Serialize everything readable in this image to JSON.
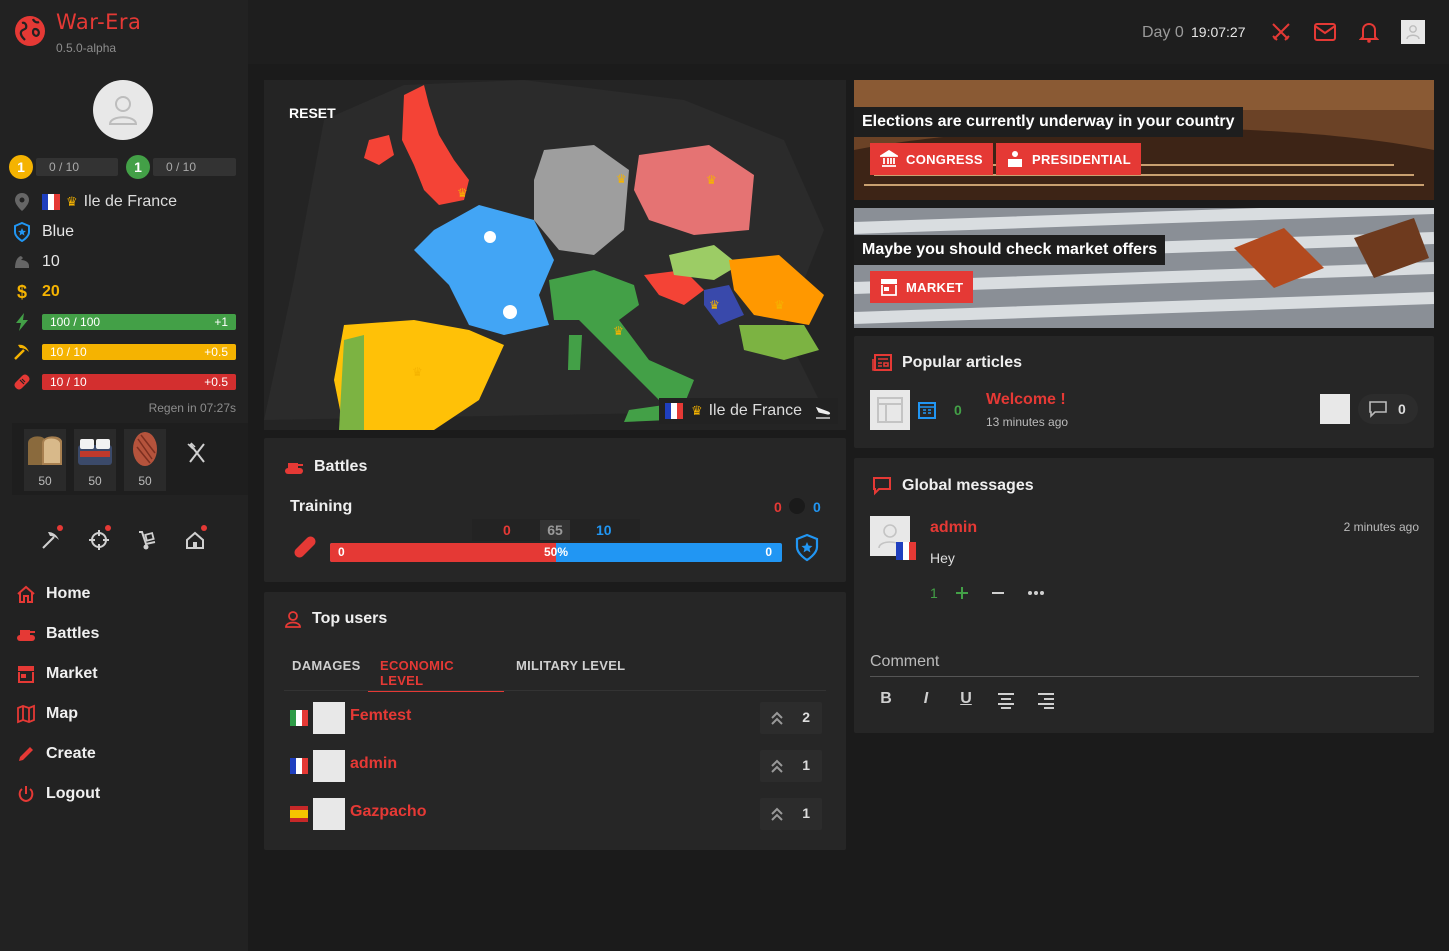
{
  "brand": {
    "name": "War-Era",
    "version": "0.5.0-alpha"
  },
  "header": {
    "day": "Day 0",
    "time": "19:07:27"
  },
  "colors": {
    "accent": "#e53935",
    "green": "#43a047",
    "yellow": "#f5b301",
    "blue": "#2196f3"
  },
  "profile": {
    "level_left": {
      "badge": "1",
      "value": "0 / 10"
    },
    "level_right": {
      "badge": "1",
      "value": "0 / 10"
    },
    "region": "Ile de France",
    "party": "Blue",
    "strength": "10",
    "money": "20",
    "energy": {
      "value": "100 / 100",
      "gain": "+1",
      "fraction": 1.0
    },
    "work": {
      "value": "10 / 10",
      "gain": "+0.5",
      "fraction": 1.0
    },
    "health": {
      "value": "10 / 10",
      "gain": "+0.5",
      "fraction": 1.0
    },
    "regen": "Regen in 07:27s"
  },
  "food": [
    {
      "name": "bread-icon",
      "count": "50"
    },
    {
      "name": "sushi-icon",
      "count": "50"
    },
    {
      "name": "steak-icon",
      "count": "50"
    }
  ],
  "nav": {
    "home": "Home",
    "battles": "Battles",
    "market": "Market",
    "map": "Map",
    "create": "Create",
    "logout": "Logout"
  },
  "map": {
    "reset": "RESET",
    "location": "Ile de France"
  },
  "banners": {
    "elections": {
      "title": "Elections are currently underway in your country",
      "congress": "CONGRESS",
      "presidential": "PRESIDENTIAL"
    },
    "market": {
      "title": "Maybe you should check market offers",
      "market": "MARKET"
    }
  },
  "battles": {
    "title": "Battles",
    "name": "Training",
    "score_left": "0",
    "score_right": "0",
    "stats_left": "0",
    "stats_mid": "65",
    "stats_right": "10",
    "bar_left": "0",
    "bar_mid": "50%",
    "bar_right": "0",
    "fraction": 0.5
  },
  "top_users": {
    "title": "Top users",
    "tabs": [
      "DAMAGES",
      "ECONOMIC LEVEL",
      "MILITARY LEVEL"
    ],
    "rows": [
      {
        "name": "Femtest",
        "rank": "2",
        "flag": "italy"
      },
      {
        "name": "admin",
        "rank": "1",
        "flag": "france"
      },
      {
        "name": "Gazpacho",
        "rank": "1",
        "flag": "spain"
      }
    ]
  },
  "articles": {
    "title": "Popular articles",
    "count": "0",
    "headline": "Welcome !",
    "time": "13 minutes ago",
    "comments": "0"
  },
  "messages": {
    "title": "Global messages",
    "author": "admin",
    "time": "2 minutes ago",
    "text": "Hey",
    "votes": "1",
    "comment_label": "Comment",
    "editor": [
      "B",
      "I",
      "U"
    ]
  }
}
